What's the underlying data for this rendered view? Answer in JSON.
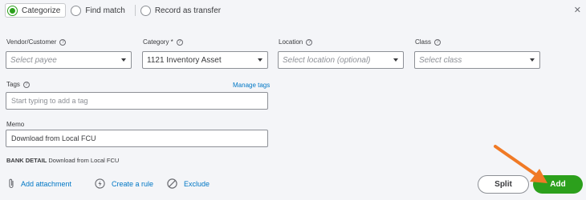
{
  "match_options": {
    "categorize": "Categorize",
    "find_match": "Find match",
    "record_transfer": "Record as transfer"
  },
  "fields": {
    "vendor_label": "Vendor/Customer",
    "vendor_placeholder": "Select payee",
    "category_label": "Category *",
    "category_value": "1121 Inventory Asset",
    "location_label": "Location",
    "location_placeholder": "Select location (optional)",
    "class_label": "Class",
    "class_placeholder": "Select class",
    "tags_label": "Tags",
    "manage_tags": "Manage tags",
    "tags_placeholder": "Start typing to add a tag",
    "memo_label": "Memo",
    "memo_value": "Download from Local FCU"
  },
  "bank_detail": {
    "label": "BANK DETAIL",
    "value": "Download from Local FCU"
  },
  "actions": {
    "add_attachment": "Add attachment",
    "create_rule": "Create a rule",
    "exclude": "Exclude"
  },
  "buttons": {
    "split": "Split",
    "add": "Add"
  },
  "colors": {
    "accent_green": "#2ca01c",
    "link_blue": "#0077c5",
    "annotation_arrow": "#f07a26"
  }
}
